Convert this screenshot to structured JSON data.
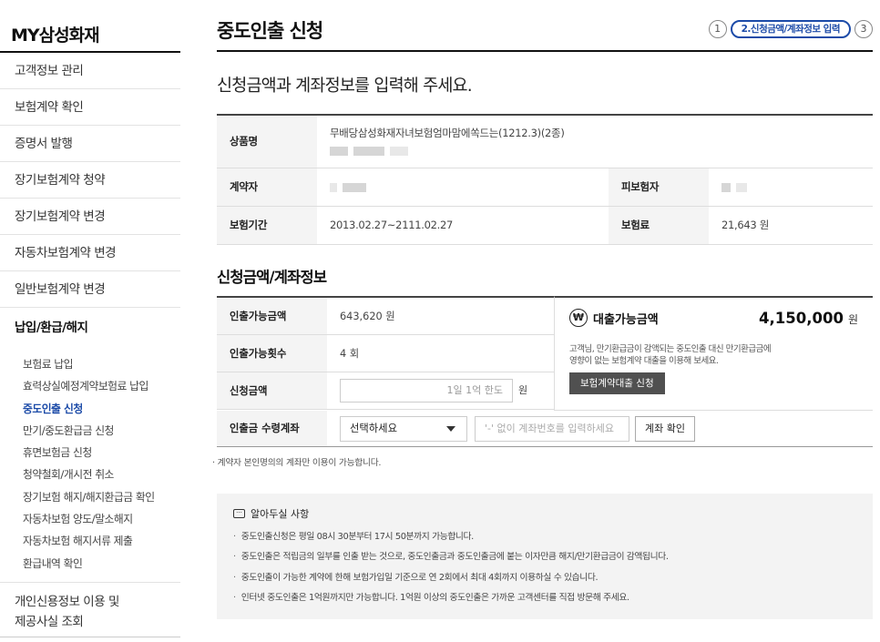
{
  "sidebar": {
    "title": "MY삼성화재",
    "items": [
      "고객정보 관리",
      "보험계약 확인",
      "증명서 발행",
      "장기보험계약 청약",
      "장기보험계약 변경",
      "자동차보험계약 변경",
      "일반보험계약 변경"
    ],
    "group": {
      "label": "납입/환급/해지",
      "subitems": [
        "보험료 납입",
        "효력상실예정계약보험료 납입",
        "중도인출 신청",
        "만기/중도환급금 신청",
        "휴면보험금 신청",
        "청약철회/개시전 취소",
        "장기보험 해지/해지환급금 확인",
        "자동차보험 양도/말소해지",
        "자동차보험 해지서류 제출",
        "환급내역 확인"
      ],
      "active_index": 2
    },
    "last_item_line1": "개인신용정보 이용 및",
    "last_item_line2": "제공사실 조회"
  },
  "header": {
    "title": "중도인출 신청",
    "steps": {
      "step1": "1",
      "step2": "2.신청금액/계좌정보 입력",
      "step3": "3"
    }
  },
  "subheading": "신청금액과 계좌정보를 입력해 주세요.",
  "contract": {
    "product_label": "상품명",
    "product_value": "무배당삼성화재자녀보험엄마맘에쏙드는(1212.3)(2종)",
    "holder_label": "계약자",
    "insured_label": "피보험자",
    "period_label": "보험기간",
    "period_value": "2013.02.27~2111.02.27",
    "premium_label": "보험료",
    "premium_value": "21,643 원"
  },
  "section_title": "신청금액/계좌정보",
  "form": {
    "available_label": "인출가능금액",
    "available_value": "643,620 원",
    "count_label": "인출가능횟수",
    "count_value": "4 회",
    "amount_label": "신청금액",
    "amount_placeholder": "1일 1억 한도",
    "amount_unit": "원",
    "account_label": "인출금 수령계좌",
    "account_select": "선택하세요",
    "account_placeholder": "'-' 없이 계좌번호를 입력하세요",
    "account_button": "계좌 확인"
  },
  "loan": {
    "icon": "₩",
    "label": "대출가능금액",
    "value": "4,150,000",
    "unit": "원",
    "desc_line1": "고객님, 만기환급금이 감액되는 중도인출 대신 만기환급금에",
    "desc_line2": "영향이 없는 보험계약 대출을 이용해 보세요.",
    "button": "보험계약대출 신청"
  },
  "note": "· 계약자 본인명의의 계좌만 이용이 가능합니다.",
  "info": {
    "title": "알아두실 사항",
    "items": [
      "중도인출신청은 평일 08시 30분부터 17시 50분까지 가능합니다.",
      "중도인출은 적립금의 일부를 인출 받는 것으로, 중도인출금과 중도인출금에 붙는 이자만큼 해지/만기환급금이 감액됩니다.",
      "중도인출이 가능한 계약에 한해 보험가입일 기준으로 연 2회에서 최대 4회까지 이용하실 수 있습니다.",
      "인터넷 중도인출은 1억원까지만 가능합니다. 1억원 이상의 중도인출은 가까운 고객센터를 직접 방문해 주세요."
    ]
  }
}
